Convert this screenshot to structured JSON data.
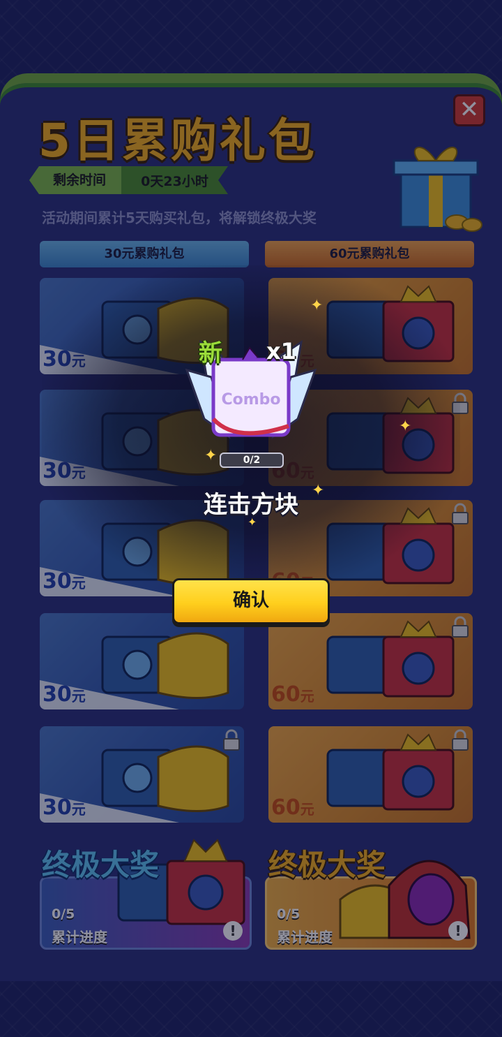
{
  "header": {
    "title": "5日累购礼包",
    "timer_label": "剩余时间",
    "timer_value": "0天23小时",
    "description": "活动期间累计5天购买礼包，将解锁终极大奖",
    "close_symbol": "✕"
  },
  "tabs": [
    {
      "label": "30元累购礼包"
    },
    {
      "label": "60元累购礼包"
    }
  ],
  "cards_30": [
    {
      "price": "30",
      "unit": "元",
      "locked": false
    },
    {
      "price": "30",
      "unit": "元",
      "locked": false
    },
    {
      "price": "30",
      "unit": "元",
      "locked": false
    },
    {
      "price": "30",
      "unit": "元",
      "locked": true
    },
    {
      "price": "30",
      "unit": "元",
      "locked": true
    }
  ],
  "cards_60": [
    {
      "price": "60",
      "unit": "元",
      "locked": false
    },
    {
      "price": "60",
      "unit": "元",
      "locked": true
    },
    {
      "price": "60",
      "unit": "元",
      "locked": true
    },
    {
      "price": "60",
      "unit": "元",
      "locked": true
    },
    {
      "price": "60",
      "unit": "元",
      "locked": true
    }
  ],
  "grand_prizes": [
    {
      "title": "终极大奖",
      "progress": "0/5",
      "progress_label": "累计进度"
    },
    {
      "title": "终极大奖",
      "progress": "0/5",
      "progress_label": "累计进度"
    }
  ],
  "reward_popup": {
    "new_tag": "新",
    "quantity": "x1",
    "item_logo": "Combo",
    "progress": "0/2",
    "item_name": "连击方块",
    "confirm_label": "确认"
  },
  "icons": {
    "close": "close-icon",
    "lock": "lock-icon",
    "info": "info-icon",
    "gift": "gift-box-icon",
    "chest": "treasure-chest-icon",
    "wings": "wings-icon"
  },
  "colors": {
    "background": "#1e2361",
    "panel": "#2a3178",
    "accent_green": "#6fa83b",
    "title_gold": "#f5b01c",
    "tab_blue": "#3c86c8",
    "tab_orange": "#cc6b1e",
    "confirm_yellow": "#ffcf1d"
  }
}
